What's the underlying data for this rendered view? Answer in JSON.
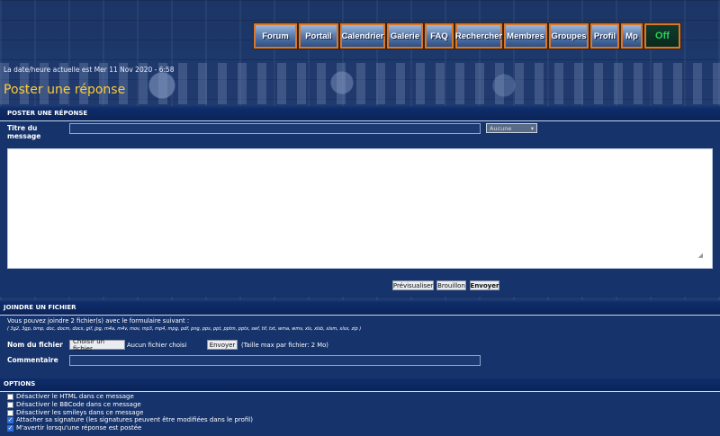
{
  "nav": {
    "items": [
      "Forum",
      "Portail",
      "Calendrier",
      "Galerie",
      "FAQ",
      "Rechercher",
      "Membres",
      "Groupes",
      "Profil",
      "Mp",
      "Off"
    ]
  },
  "header": {
    "date_text": "La date/heure actuelle est Mer 11 Nov 2020 - 6:58",
    "page_title": "Poster une réponse"
  },
  "post_section": {
    "title": "POSTER UNE RÉPONSE",
    "subject_label": "Titre du message",
    "subject_value": "",
    "icon_select_value": "Aucune",
    "message_value": ""
  },
  "actions": {
    "preview_label": "Prévisualiser",
    "draft_label": "Brouillon",
    "send_label": "Envoyer"
  },
  "attach_section": {
    "title": "JOINDRE UN FICHIER",
    "intro": "Vous pouvez joindre 2 fichier(s) avec le formulaire suivant :",
    "extensions": "( 3g2, 3gp, bmp, doc, docm, docx, gif, jpg, m4a, m4v, mov, mp3, mp4, mpg, pdf, png, pps, ppt, pptm, pptx, swf, tif, txt, wma, wmv, xls, xlsb, xlsm, xlsx, zip )",
    "file_label": "Nom du fichier",
    "choose_button": "Choisir un fichier",
    "no_file": "Aucun fichier choisi",
    "upload_button": "Envoyer",
    "max_size": "(Taille max par fichier: 2 Mo)",
    "comment_label": "Commentaire",
    "comment_value": ""
  },
  "options_section": {
    "title": "OPTIONS",
    "items": [
      {
        "label": "Désactiver le HTML dans ce message",
        "checked": false
      },
      {
        "label": "Désactiver le BBCode dans ce message",
        "checked": false
      },
      {
        "label": "Désactiver les smileys dans ce message",
        "checked": false
      },
      {
        "label": "Attacher sa signature (les signatures peuvent être modifiées dans le profil)",
        "checked": true
      },
      {
        "label": "M'avertir lorsqu'une réponse est postée",
        "checked": true
      }
    ]
  }
}
